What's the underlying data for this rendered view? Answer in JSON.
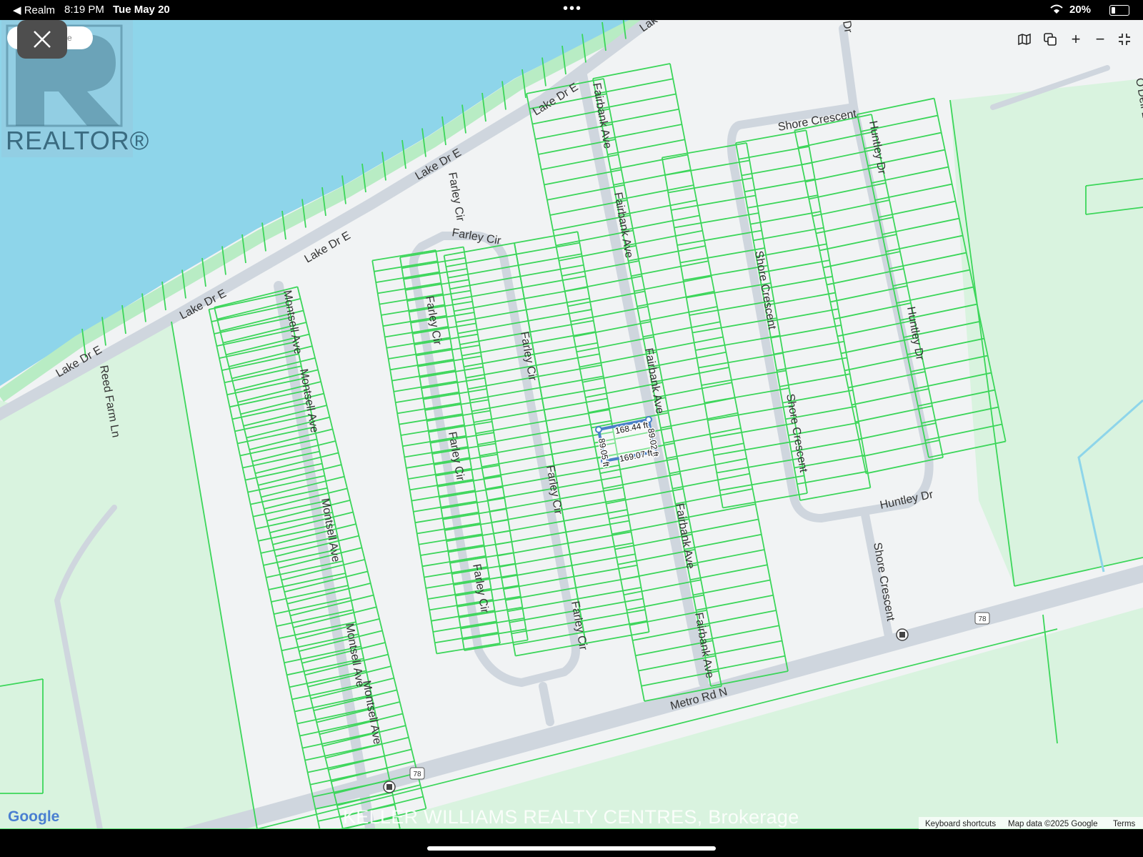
{
  "status_bar": {
    "back_app": "◀ Realm",
    "time": "8:19 PM",
    "date": "Tue May 20",
    "battery": "20%",
    "dots": "•••"
  },
  "overlay": {
    "realtor_logo_text": "REALTOR®",
    "search_fragment": "re"
  },
  "map_controls": {
    "map_type_icon": "map-icon",
    "layers_icon": "layers-icon",
    "zoom_in": "+",
    "zoom_out": "−",
    "collapse_icon": "collapse-icon"
  },
  "roads": {
    "lake_dr_e": "Lake Dr E",
    "lake_dr_e_top": "Lak",
    "reed_farm_ln": "Reed Farm Ln",
    "montsell_ave": "Montsell Ave",
    "farley_cir": "Farley Cir",
    "fairbank_ave": "Fairbank Ave",
    "shore_crescent": "Shore Crescent",
    "huntley_dr": "Huntley Dr",
    "metro_rd_n": "Metro Rd N",
    "route_78": "78",
    "top_dr": "Dr",
    "odell": "O'Dell Ln"
  },
  "measurements": {
    "top": "168.44 ft",
    "right": "89.02 ft",
    "bottom": "169.07 ft",
    "left": "89.05 ft"
  },
  "footer": {
    "watermark": "KELLER WILLIAMS REALTY CENTRES, Brokerage",
    "google": "Google",
    "keyboard_shortcuts": "Keyboard shortcuts",
    "map_data": "Map data ©2025 Google",
    "terms": "Terms"
  },
  "colors": {
    "water": "#8ed5ea",
    "parcel_line": "#3cd65a",
    "road": "#cfd6de",
    "green_area": "#d9f3df",
    "measure": "#4a80c8"
  }
}
